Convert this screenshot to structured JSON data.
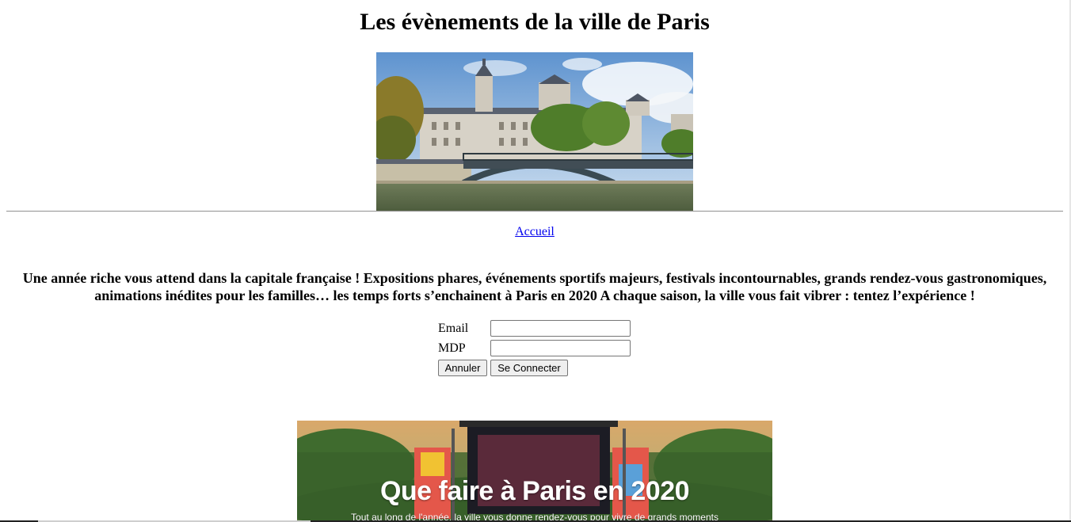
{
  "page": {
    "title": "Les évènements de la ville de Paris"
  },
  "nav": {
    "home_label": "Accueil"
  },
  "intro": {
    "text": "Une année riche vous attend dans la capitale française ! Expositions phares, événements sportifs majeurs, festivals incontournables, grands rendez-vous gastronomiques, animations inédites pour les familles… les temps forts s’enchainent à Paris en 2020 A chaque saison, la ville vous fait vibrer : tentez l’expérience !"
  },
  "login": {
    "email_label": "Email",
    "email_value": "",
    "password_label": "MDP",
    "password_value": "",
    "cancel_label": "Annuler",
    "connect_label": "Se Connecter"
  },
  "banner": {
    "title": "Que faire à Paris en 2020",
    "subtitle": "Tout au long de l'année, la ville vous donne rendez-vous pour vivre de grands moments"
  },
  "colors": {
    "link": "#0000ee",
    "button_bg": "#efefef",
    "button_border": "#767676",
    "divider": "#9a9a9a"
  }
}
